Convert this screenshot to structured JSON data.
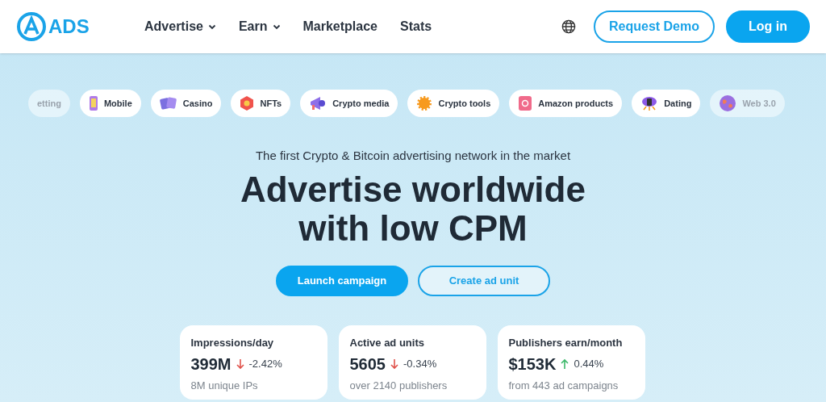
{
  "header": {
    "logo": "ADS",
    "nav": [
      {
        "label": "Advertise",
        "dropdown": true
      },
      {
        "label": "Earn",
        "dropdown": true
      },
      {
        "label": "Marketplace",
        "dropdown": false
      },
      {
        "label": "Stats",
        "dropdown": false
      }
    ],
    "buttons": [
      {
        "label": "Request Demo",
        "kind": "outline"
      },
      {
        "label": "Log in",
        "kind": "solid"
      }
    ]
  },
  "categories": [
    {
      "label": "etting",
      "faded": true
    },
    {
      "label": "Mobile",
      "faded": false
    },
    {
      "label": "Casino",
      "faded": false
    },
    {
      "label": "NFTs",
      "faded": false
    },
    {
      "label": "Crypto media",
      "faded": false
    },
    {
      "label": "Crypto tools",
      "faded": false
    },
    {
      "label": "Amazon products",
      "faded": false
    },
    {
      "label": "Dating",
      "faded": false
    },
    {
      "label": "Web 3.0",
      "faded": true
    }
  ],
  "hero": {
    "subtitle": "The first Crypto & Bitcoin advertising network in the market",
    "title_lines": [
      "Advertise worldwide",
      "with low CPM"
    ],
    "buttons": [
      {
        "label": "Launch campaign",
        "kind": "solid"
      },
      {
        "label": "Create ad unit",
        "kind": "outline"
      }
    ]
  },
  "stats": [
    {
      "label": "Impressions/day",
      "value": "399M",
      "kind": "down",
      "change": "-2.42%",
      "note": "8M unique IPs"
    },
    {
      "label": "Active ad units",
      "value": "5605",
      "kind": "down",
      "change": "-0.34%",
      "note": "over 2140 publishers"
    },
    {
      "label": "Publishers earn/month",
      "value": "$153K",
      "kind": "up",
      "change": "0.44%",
      "note": "from 443 ad campaigns"
    }
  ]
}
